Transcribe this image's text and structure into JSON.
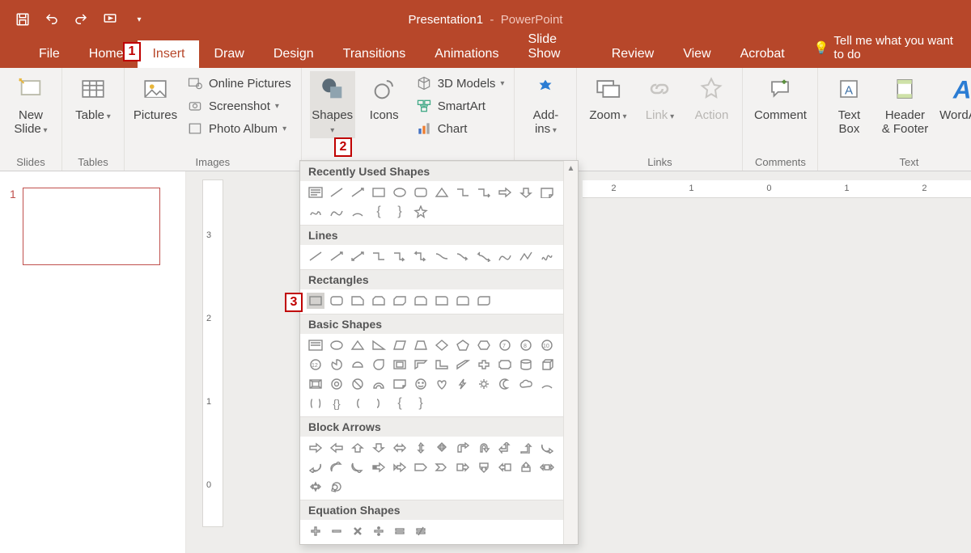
{
  "app": {
    "title": "Presentation1",
    "subtitle": "PowerPoint"
  },
  "qat": {
    "save": "Save",
    "undo": "Undo",
    "redo": "Redo",
    "start": "Start From Beginning"
  },
  "tabs": {
    "file": "File",
    "home": "Home",
    "insert": "Insert",
    "draw": "Draw",
    "design": "Design",
    "transitions": "Transitions",
    "animations": "Animations",
    "slideshow": "Slide Show",
    "review": "Review",
    "view": "View",
    "acrobat": "Acrobat",
    "tellme": "Tell me what you want to do"
  },
  "ribbon": {
    "slides": {
      "new_slide": "New\nSlide",
      "group": "Slides"
    },
    "tables": {
      "table": "Table",
      "group": "Tables"
    },
    "images": {
      "pictures": "Pictures",
      "online": "Online Pictures",
      "screenshot": "Screenshot",
      "album": "Photo Album",
      "group": "Images"
    },
    "illustrations": {
      "shapes": "Shapes",
      "icons": "Icons",
      "models": "3D Models",
      "smartart": "SmartArt",
      "chart": "Chart"
    },
    "addins": {
      "addins": "Add-\nins"
    },
    "links": {
      "zoom": "Zoom",
      "link": "Link",
      "action": "Action",
      "group": "Links"
    },
    "comments": {
      "comment": "Comment",
      "group": "Comments"
    },
    "text": {
      "textbox": "Text\nBox",
      "header": "Header\n& Footer",
      "wordart": "WordArt",
      "group": "Text"
    }
  },
  "shapes_panel": {
    "recent": "Recently Used Shapes",
    "lines": "Lines",
    "rectangles": "Rectangles",
    "basic": "Basic Shapes",
    "arrows": "Block Arrows",
    "equation": "Equation Shapes"
  },
  "thumbnails": {
    "first": "1"
  },
  "ruler": {
    "v": [
      "3",
      "2",
      "1",
      "0"
    ],
    "h": [
      "2",
      "1",
      "0",
      "1",
      "2"
    ]
  },
  "callouts": {
    "c1": "1",
    "c2": "2",
    "c3": "3"
  }
}
